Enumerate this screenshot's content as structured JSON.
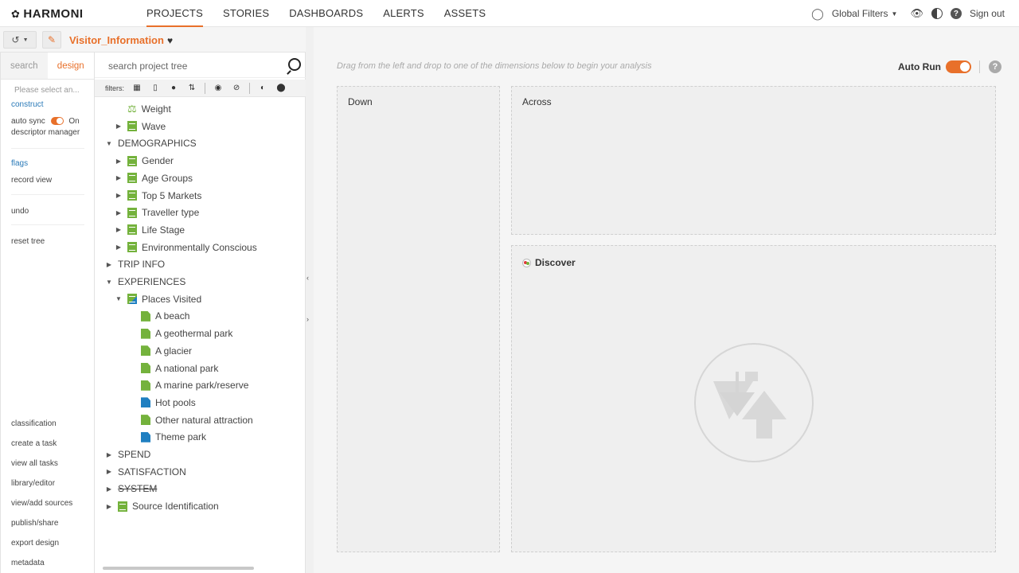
{
  "app": {
    "logo": "HARMONI"
  },
  "nav": {
    "items": [
      "PROJECTS",
      "STORIES",
      "DASHBOARDS",
      "ALERTS",
      "ASSETS"
    ],
    "active": 0
  },
  "topright": {
    "global_filters": "Global Filters",
    "signout": "Sign out"
  },
  "project": {
    "title": "Visitor_Information"
  },
  "leftpanel": {
    "tabs": [
      "search",
      "design"
    ],
    "active_tab": 1,
    "select_placeholder": "Please select an...",
    "construct": "construct",
    "auto_sync": "auto sync",
    "auto_sync_state": "On",
    "descriptor_manager": "descriptor manager",
    "flags": "flags",
    "record_view": "record view",
    "undo": "undo",
    "reset_tree": "reset tree",
    "bottom": [
      "classification",
      "create a task",
      "view all tasks",
      "library/editor",
      "view/add sources",
      "publish/share",
      "export design",
      "metadata"
    ]
  },
  "tree": {
    "search_placeholder": "search project tree",
    "filters_label": "filters:",
    "nodes": [
      {
        "label": "Weight",
        "level": 1,
        "icon": "weight-icon",
        "arrow": ""
      },
      {
        "label": "Wave",
        "level": 1,
        "icon": "wave-icon",
        "arrow": "right"
      },
      {
        "label": "DEMOGRAPHICS",
        "level": 0,
        "icon": "",
        "arrow": "down"
      },
      {
        "label": "Gender",
        "level": 1,
        "icon": "variable-icon",
        "arrow": "right"
      },
      {
        "label": "Age Groups",
        "level": 1,
        "icon": "variable-icon",
        "arrow": "right"
      },
      {
        "label": "Top 5 Markets",
        "level": 1,
        "icon": "variable-icon",
        "arrow": "right"
      },
      {
        "label": "Traveller type",
        "level": 1,
        "icon": "variable-icon",
        "arrow": "right"
      },
      {
        "label": "Life Stage",
        "level": 1,
        "icon": "variable-icon",
        "arrow": "right"
      },
      {
        "label": "Environmentally Conscious",
        "level": 1,
        "icon": "variable-icon",
        "arrow": "right"
      },
      {
        "label": "TRIP INFO",
        "level": 0,
        "icon": "",
        "arrow": "right"
      },
      {
        "label": "EXPERIENCES",
        "level": 0,
        "icon": "",
        "arrow": "down"
      },
      {
        "label": "Places Visited",
        "level": 1,
        "icon": "multi-variable-icon",
        "arrow": "down"
      },
      {
        "label": "A beach",
        "level": 2,
        "icon": "green-leaf-icon",
        "arrow": ""
      },
      {
        "label": "A geothermal park",
        "level": 2,
        "icon": "green-leaf-icon",
        "arrow": ""
      },
      {
        "label": "A glacier",
        "level": 2,
        "icon": "green-leaf-icon",
        "arrow": ""
      },
      {
        "label": "A national park",
        "level": 2,
        "icon": "green-leaf-icon",
        "arrow": ""
      },
      {
        "label": "A marine park/reserve",
        "level": 2,
        "icon": "green-leaf-icon",
        "arrow": ""
      },
      {
        "label": "Hot pools",
        "level": 2,
        "icon": "blue-leaf-icon",
        "arrow": ""
      },
      {
        "label": "Other natural attraction",
        "level": 2,
        "icon": "green-leaf-icon",
        "arrow": ""
      },
      {
        "label": "Theme park",
        "level": 2,
        "icon": "blue-leaf-icon",
        "arrow": ""
      },
      {
        "label": "SPEND",
        "level": 0,
        "icon": "",
        "arrow": "right"
      },
      {
        "label": "SATISFACTION",
        "level": 0,
        "icon": "",
        "arrow": "right"
      },
      {
        "label": "SYSTEM",
        "level": 0,
        "icon": "",
        "arrow": "right"
      },
      {
        "label": "Source Identification",
        "level": 0,
        "icon": "source-icon",
        "arrow": "right"
      }
    ]
  },
  "main": {
    "hint": "Drag from the left and drop to one of the dimensions below to begin your analysis",
    "auto_run": "Auto Run",
    "auto_run_on": true,
    "down": "Down",
    "across": "Across",
    "discover": "Discover"
  },
  "colors": {
    "accent": "#e8702a",
    "link": "#2a7ab8",
    "green": "#74b23c",
    "blue": "#1f7fc1"
  }
}
